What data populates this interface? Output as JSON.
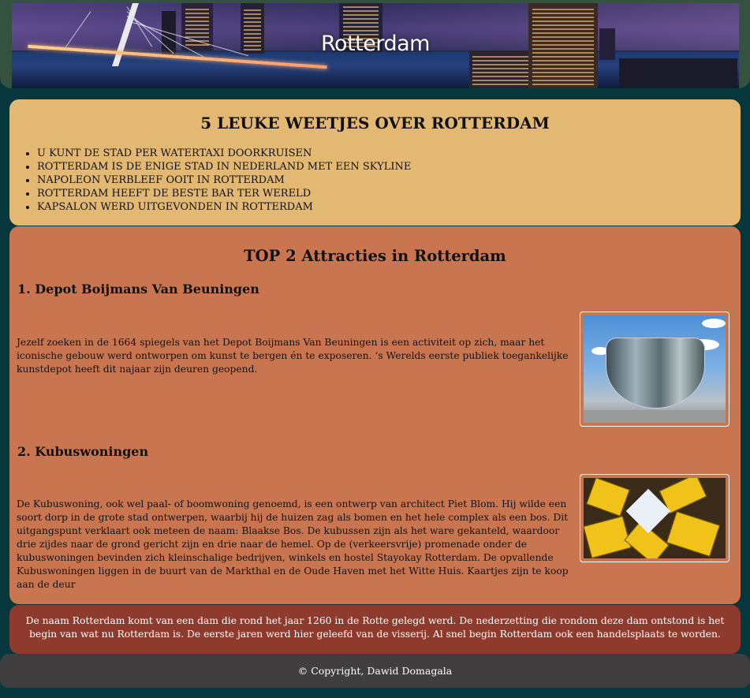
{
  "header": {
    "banner_title": "Rotterdam"
  },
  "facts": {
    "heading": "5 LEUKE WEETJES OVER ROTTERDAM",
    "items": [
      "U KUNT DE STAD PER WATERTAXI DOORKRUISEN",
      "ROTTERDAM IS DE ENIGE STAD IN NEDERLAND MET EEN SKYLINE",
      "NAPOLEON VERBLEEF OOIT IN ROTTERDAM",
      "ROTTERDAM HEEFT DE BESTE BAR TER WERELD",
      "KAPSALON WERD UITGEVONDEN IN ROTTERDAM"
    ]
  },
  "attractions": {
    "heading": "TOP 2 Attracties in Rotterdam",
    "items": [
      {
        "title": "1. Depot Boijmans Van Beuningen",
        "text": "Jezelf zoeken in de 1664 spiegels van het Depot Boijmans Van Beuningen is een activiteit op zich, maar het iconische gebouw werd ontworpen om kunst te bergen én te exposeren. ‘s Werelds eerste publiek toegankelijke kunstdepot heeft dit najaar zijn deuren geopend."
      },
      {
        "title": "2. Kubuswoningen",
        "text": "De Kubuswoning, ook wel paal- of boomwoning genoemd, is een ontwerp van architect Piet Blom. Hij wilde een soort dorp in de grote stad ontwerpen, waarbij hij de huizen zag als bomen en het hele complex als een bos. Dit uitgangspunt verklaart ook meteen de naam: Blaakse Bos. De kubussen zijn als het ware gekanteld, waardoor drie zijdes naar de grond gericht zijn en drie naar de hemel. Op de (verkeersvrije) promenade onder de kubuswoningen bevinden zich kleinschalige bedrijven, winkels en hostel Stayokay Rotterdam. De opvallende Kubuswoningen liggen in de buurt van de Markthal en de Oude Haven met het Witte Huis. Kaartjes zijn te koop aan de deur"
      }
    ]
  },
  "about": {
    "text": "De naam Rotterdam komt van een dam die rond het jaar 1260 in de Rotte gelegd werd. De nederzetting die rondom deze dam ontstond is het begin van wat nu Rotterdam is. De eerste jaren werd hier geleefd van de visserij. Al snel begin Rotterdam ook een handelsplaats te worden."
  },
  "footer": {
    "copyright": "© Copyright, Dawid Domagala"
  }
}
